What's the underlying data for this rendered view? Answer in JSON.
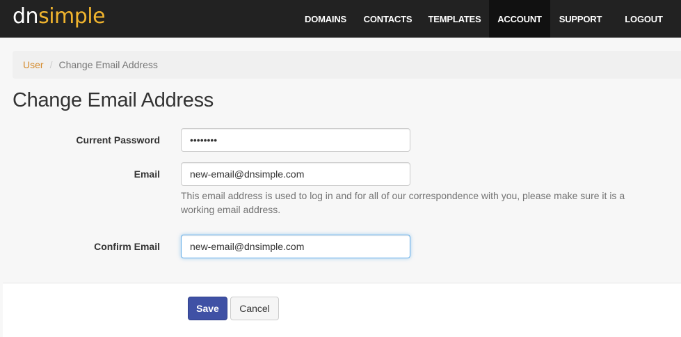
{
  "brand": {
    "part1": "dn",
    "part2": "simple"
  },
  "nav": {
    "items": [
      {
        "label": "DOMAINS"
      },
      {
        "label": "CONTACTS"
      },
      {
        "label": "TEMPLATES"
      },
      {
        "label": "ACCOUNT",
        "active": true
      },
      {
        "label": "SUPPORT"
      },
      {
        "label": "LOGOUT"
      }
    ]
  },
  "breadcrumb": {
    "parent": "User",
    "separator": "/",
    "current": "Change Email Address"
  },
  "page": {
    "title": "Change Email Address"
  },
  "form": {
    "current_password": {
      "label": "Current Password",
      "value": "••••••••"
    },
    "email": {
      "label": "Email",
      "value": "new-email@dnsimple.com",
      "help": "This email address is used to log in and for all of our correspondence with you, please make sure it is a working email address."
    },
    "confirm_email": {
      "label": "Confirm Email",
      "value": "new-email@dnsimple.com"
    }
  },
  "actions": {
    "save_label": "Save",
    "cancel_label": "Cancel"
  },
  "colors": {
    "navbar": "#222222",
    "brand_accent": "#f0b42e",
    "link": "#d48a2c",
    "primary_button": "#3f51a5",
    "focus_border": "#66afe9"
  }
}
